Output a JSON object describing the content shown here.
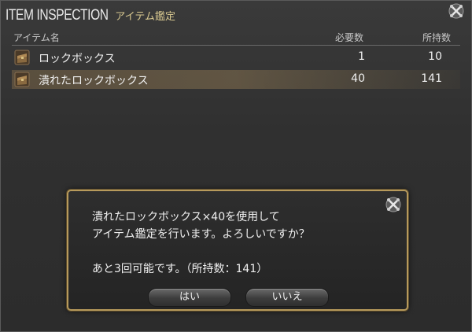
{
  "window": {
    "title": "ITEM INSPECTION",
    "subtitle": "アイテム鑑定",
    "close_icon": "crossed-swords-close-icon"
  },
  "columns": {
    "name": "アイテム名",
    "required": "必要数",
    "owned": "所持数"
  },
  "items": [
    {
      "name": "ロックボックス",
      "required": "1",
      "owned": "10",
      "icon": "chest-icon",
      "selected": false
    },
    {
      "name": "潰れたロックボックス",
      "required": "40",
      "owned": "141",
      "icon": "chest-icon",
      "selected": true
    }
  ],
  "dialog": {
    "line1": "潰れたロックボックス×40を使用して",
    "line2": "アイテム鑑定を行います。よろしいですか？",
    "line3": "あと3回可能です。（所持数：141）",
    "yes_label": "はい",
    "no_label": "いいえ",
    "close_icon": "crossed-swords-close-icon"
  },
  "colors": {
    "accent_gold": "#b79a5c",
    "subtitle": "#d8c890",
    "selection": "#967d55"
  }
}
